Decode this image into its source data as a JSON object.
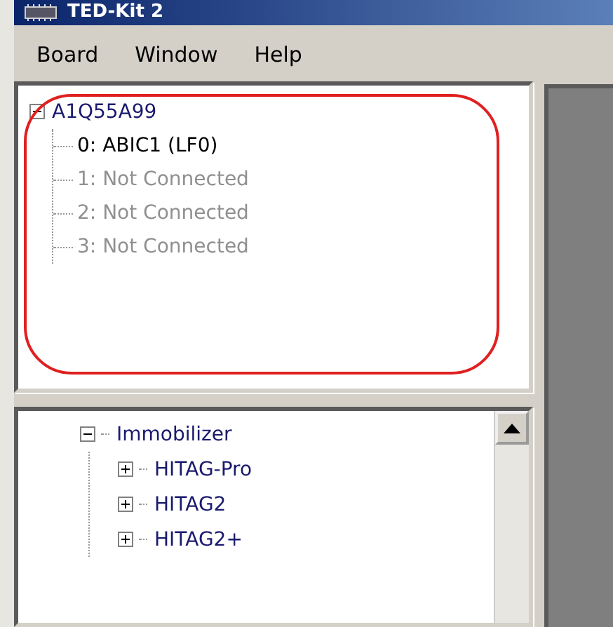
{
  "window": {
    "title": "TED-Kit 2"
  },
  "menu": [
    "Board",
    "Window",
    "Help"
  ],
  "board_tree": {
    "label": "A1Q55A99",
    "expanded": true,
    "children": [
      {
        "label": "0: ABIC1 (LF0)",
        "connected": true
      },
      {
        "label": "1: Not Connected",
        "connected": false
      },
      {
        "label": "2: Not Connected",
        "connected": false
      },
      {
        "label": "3: Not Connected",
        "connected": false
      }
    ]
  },
  "feature_tree": {
    "label": "Immobilizer",
    "expanded": true,
    "children": [
      {
        "label": "HITAG-Pro",
        "expanded": false
      },
      {
        "label": "HITAG2",
        "expanded": false
      },
      {
        "label": "HITAG2+",
        "expanded": false
      }
    ]
  }
}
